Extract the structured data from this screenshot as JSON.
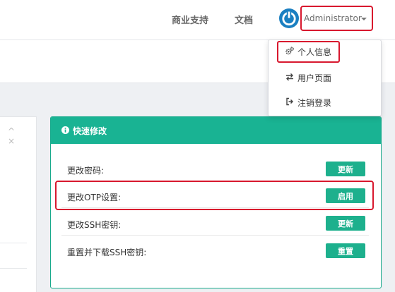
{
  "nav": {
    "support": "商业支持",
    "docs": "文档",
    "user": "Administrator"
  },
  "dropdown": {
    "items": [
      {
        "label": "个人信息",
        "icon": "cogs-icon"
      },
      {
        "label": "用户页面",
        "icon": "exchange-icon"
      },
      {
        "label": "注销登录",
        "icon": "sign-out-icon"
      }
    ]
  },
  "left_panel": {
    "tools": [
      "^",
      "×"
    ]
  },
  "quick": {
    "title": "快速修改",
    "rows": [
      {
        "label": "更改密码:",
        "button": "更新"
      },
      {
        "label": "更改OTP设置:",
        "button": "启用"
      },
      {
        "label": "更改SSH密钥:",
        "button": "更新"
      },
      {
        "label": "重置并下载SSH密钥:",
        "button": "重置"
      }
    ]
  },
  "colors": {
    "accent": "#19b393",
    "button": "#1db08d",
    "highlight": "#d8182e",
    "logo": "#1a7fc1"
  }
}
